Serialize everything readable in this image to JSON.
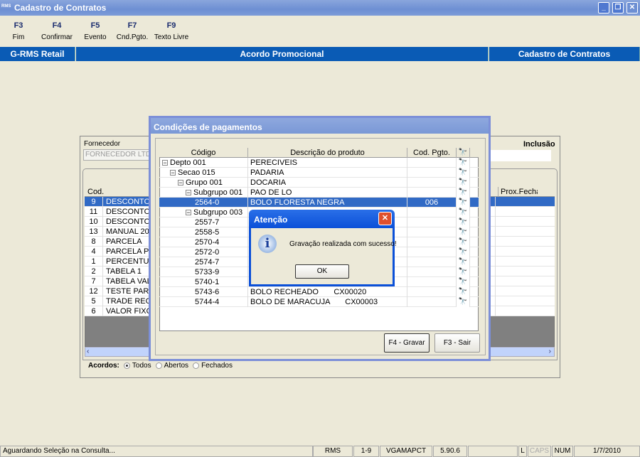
{
  "window": {
    "title": "Cadastro de Contratos",
    "logo": "RMS"
  },
  "toolbar": [
    {
      "key": "F3",
      "label": "Fim"
    },
    {
      "key": "F4",
      "label": "Confirmar"
    },
    {
      "key": "F5",
      "label": "Evento"
    },
    {
      "key": "F7",
      "label": "Cnd.Pgto."
    },
    {
      "key": "F9",
      "label": "Texto Livre"
    }
  ],
  "header": {
    "left": "G-RMS Retail",
    "center": "Acordo Promocional",
    "right": "Cadastro de Contratos"
  },
  "main": {
    "fornecedor_label": "Fornecedor",
    "fornecedor_value": "FORNECEDOR LTDA",
    "mode": "Inclusão",
    "grid_headers": {
      "cod": "Cod.",
      "prox": "Prox.Fecha"
    },
    "rows": [
      {
        "cod": "9",
        "desc": "DESCONTO"
      },
      {
        "cod": "11",
        "desc": "DESCONTO -"
      },
      {
        "cod": "10",
        "desc": "DESCONTO C"
      },
      {
        "cod": "13",
        "desc": "MANUAL 2010"
      },
      {
        "cod": "8",
        "desc": "PARCELA"
      },
      {
        "cod": "4",
        "desc": "PARCELA PR"
      },
      {
        "cod": "1",
        "desc": "PERCENTUAL"
      },
      {
        "cod": "2",
        "desc": "TABELA 1"
      },
      {
        "cod": "7",
        "desc": "TABELA VALO"
      },
      {
        "cod": "12",
        "desc": "TESTE PARC"
      },
      {
        "cod": "5",
        "desc": "TRADE RECE"
      },
      {
        "cod": "6",
        "desc": "VALOR FIXO"
      }
    ],
    "acordos_label": "Acordos:",
    "filters": [
      {
        "label": "Todos",
        "checked": true
      },
      {
        "label": "Abertos",
        "checked": false
      },
      {
        "label": "Fechados",
        "checked": false
      }
    ]
  },
  "modal": {
    "title": "Condições de pagamentos",
    "headers": [
      "Código",
      "Descrição do produto",
      "Cod. Pgto."
    ],
    "rows": [
      {
        "level": 0,
        "code": "Depto 001",
        "desc": "PERECIVEIS",
        "pgto": "",
        "toggle": true
      },
      {
        "level": 1,
        "code": "Secao 015",
        "desc": "PADARIA",
        "pgto": "",
        "toggle": true
      },
      {
        "level": 2,
        "code": "Grupo 001",
        "desc": "DOCARIA",
        "pgto": "",
        "toggle": true
      },
      {
        "level": 3,
        "code": "Subgrupo 001",
        "desc": "PAO DE LO",
        "pgto": "",
        "toggle": true
      },
      {
        "level": 4,
        "code": "2564-0",
        "desc": "BOLO FLORESTA NEGRA",
        "pgto": "006",
        "selected": true
      },
      {
        "level": 3,
        "code": "Subgrupo 003",
        "desc": "",
        "pgto": "",
        "toggle": true
      },
      {
        "level": 4,
        "code": "2557-7",
        "desc": "",
        "pgto": ""
      },
      {
        "level": 4,
        "code": "2558-5",
        "desc": "",
        "pgto": ""
      },
      {
        "level": 4,
        "code": "2570-4",
        "desc": "",
        "pgto": ""
      },
      {
        "level": 4,
        "code": "2572-0",
        "desc": "",
        "pgto": ""
      },
      {
        "level": 4,
        "code": "2574-7",
        "desc": "",
        "pgto": ""
      },
      {
        "level": 4,
        "code": "5733-9",
        "desc": "",
        "pgto": ""
      },
      {
        "level": 4,
        "code": "5740-1",
        "desc": "",
        "pgto": ""
      },
      {
        "level": 4,
        "code": "5743-6",
        "desc": "BOLO RECHEADO       CX00020",
        "pgto": ""
      },
      {
        "level": 4,
        "code": "5744-4",
        "desc": "BOLO DE MARACUJA       CX00003",
        "pgto": ""
      }
    ],
    "save_label": "F4 - Gravar",
    "exit_label": "F3 - Sair"
  },
  "alert": {
    "title": "Atenção",
    "message": "Gravação realizada com sucesso!",
    "ok": "OK",
    "icon": "info-icon"
  },
  "statusbar": {
    "message": "Aguardando Seleção na Consulta...",
    "panels": [
      "RMS",
      "1-9",
      "VGAMAPCT",
      "5.90.6",
      "",
      "L",
      "CAPS",
      "NUM",
      "1/7/2010"
    ]
  },
  "colors": {
    "selection": "#316ac5",
    "header_bar": "#0a5bb5",
    "close_red": "#e0502c"
  }
}
